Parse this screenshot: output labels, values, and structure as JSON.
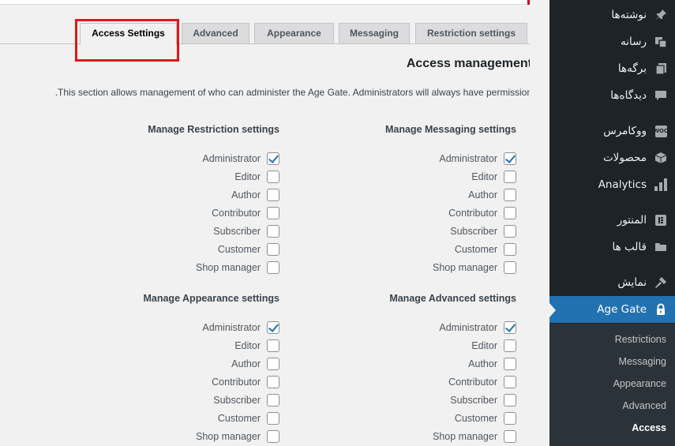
{
  "tabs": [
    {
      "label": "Access Settings",
      "active": true
    },
    {
      "label": "Advanced"
    },
    {
      "label": "Appearance"
    },
    {
      "label": "Messaging"
    },
    {
      "label": "Restriction settings"
    }
  ],
  "page": {
    "title": "Access management",
    "description": ".This section allows management of who can administer the Age Gate. Administrators will always have permission"
  },
  "roles": [
    "Administrator",
    "Editor",
    "Author",
    "Contributor",
    "Subscriber",
    "Customer",
    "Shop manager"
  ],
  "groups": {
    "restriction": {
      "title": "Manage Restriction settings",
      "checked": [
        true,
        false,
        false,
        false,
        false,
        false,
        false
      ]
    },
    "messaging": {
      "title": "Manage Messaging settings",
      "checked": [
        true,
        false,
        false,
        false,
        false,
        false,
        false
      ]
    },
    "appearance": {
      "title": "Manage Appearance settings",
      "checked": [
        true,
        false,
        false,
        false,
        false,
        false,
        false
      ]
    },
    "advanced": {
      "title": "Manage Advanced settings",
      "checked": [
        true,
        false,
        false,
        false,
        false,
        false,
        false
      ]
    }
  },
  "sidebar": {
    "items": [
      {
        "label": "نوشته‌ها",
        "icon": "pin-icon"
      },
      {
        "label": "رسانه",
        "icon": "media-icon"
      },
      {
        "label": "برگه‌ها",
        "icon": "pages-icon"
      },
      {
        "label": "دیدگاه‌ها",
        "icon": "comments-icon"
      },
      {
        "label": "ووکامرس",
        "icon": "woocommerce-icon",
        "icon_text": "WOO"
      },
      {
        "label": "محصولات",
        "icon": "products-icon"
      },
      {
        "label": "Analytics",
        "icon": "analytics-icon"
      },
      {
        "label": "المنتور",
        "icon": "elementor-icon"
      },
      {
        "label": "قالب ها",
        "icon": "folder-icon"
      },
      {
        "label": "نمایش",
        "icon": "hammer-icon"
      },
      {
        "label": "Age Gate",
        "icon": "lock-icon",
        "current": true
      }
    ],
    "submenu": [
      "Restrictions",
      "Messaging",
      "Appearance",
      "Advanced",
      "Access"
    ],
    "submenu_current": "Access"
  },
  "colors": {
    "accent": "#2271b1",
    "sidebar_bg": "#1d2327",
    "highlight": "#e0161b"
  }
}
